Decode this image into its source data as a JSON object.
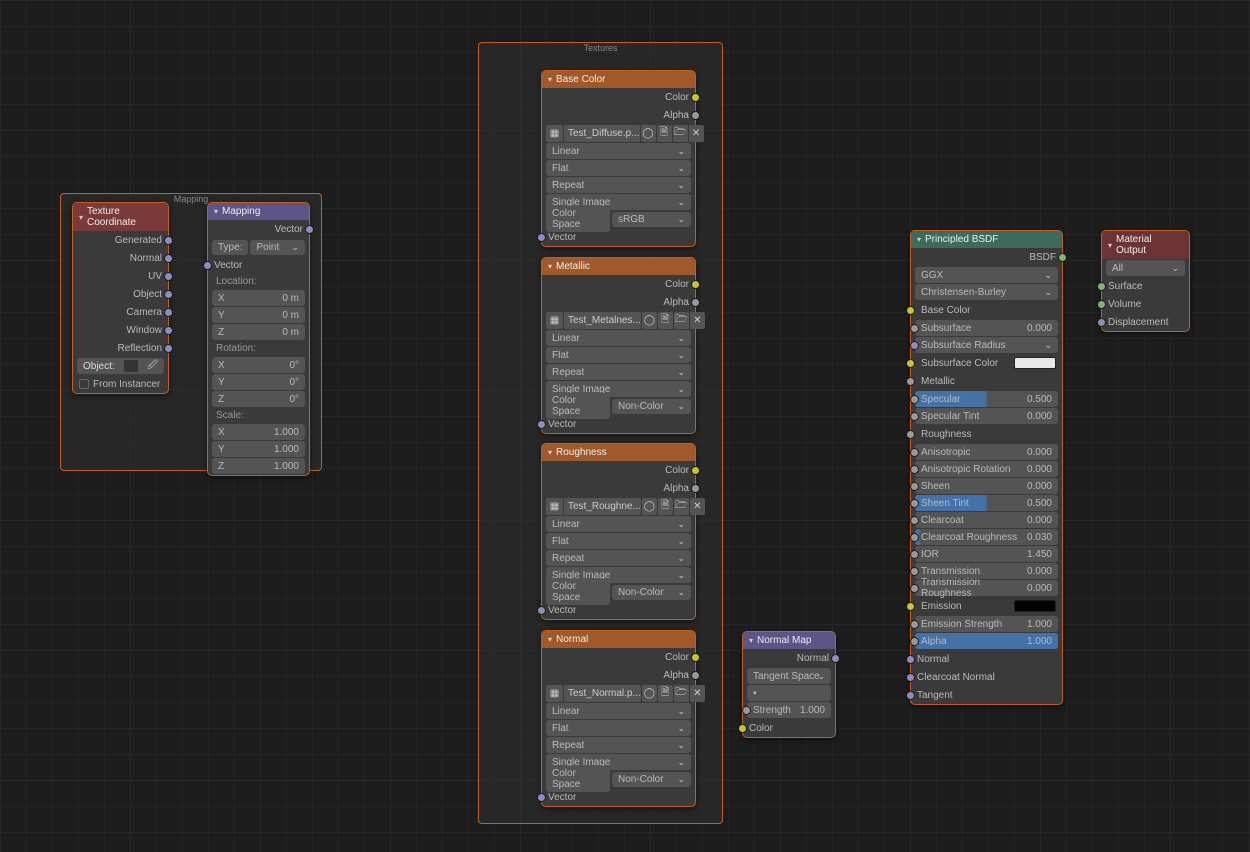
{
  "frames": {
    "mapping": "Mapping",
    "textures": "Textures"
  },
  "texCoord": {
    "title": "Texture Coordinate",
    "outs": [
      "Generated",
      "Normal",
      "UV",
      "Object",
      "Camera",
      "Window",
      "Reflection"
    ],
    "objLabel": "Object:",
    "from": "From Instancer"
  },
  "mapping": {
    "title": "Mapping",
    "out": "Vector",
    "typeLabel": "Type:",
    "type": "Point",
    "vecIn": "Vector",
    "loc": "Location:",
    "rot": "Rotation:",
    "scale": "Scale:",
    "loc_vals": [
      "0 m",
      "0 m",
      "0 m"
    ],
    "rot_vals": [
      "0°",
      "0°",
      "0°"
    ],
    "scale_vals": [
      "1.000",
      "1.000",
      "1.000"
    ],
    "axes": [
      "X",
      "Y",
      "Z"
    ]
  },
  "tex": {
    "titles": [
      "Base Color",
      "Metallic",
      "Roughness",
      "Normal"
    ],
    "files": [
      "Test_Diffuse.p...",
      "Test_Metalnes...",
      "Test_Roughne...",
      "Test_Normal.p..."
    ],
    "interp": "Linear",
    "proj": "Flat",
    "ext": "Repeat",
    "user": "Single Image",
    "csLabel": "Color Space",
    "cs": [
      "sRGB",
      "Non-Color",
      "Non-Color",
      "Non-Color"
    ],
    "outs": [
      "Color",
      "Alpha"
    ],
    "in": "Vector"
  },
  "nmap": {
    "title": "Normal Map",
    "out": "Normal",
    "space": "Tangent Space",
    "strengthL": "Strength",
    "strength": "1.000",
    "colorIn": "Color"
  },
  "bsdf": {
    "title": "Principled BSDF",
    "out": "BSDF",
    "dist": "GGX",
    "sss": "Christensen-Burley",
    "rows": [
      {
        "l": "Base Color",
        "sock": "yellow"
      },
      {
        "l": "Subsurface",
        "v": "0.000",
        "sock": "grey",
        "p": 0
      },
      {
        "l": "Subsurface Radius",
        "sock": "lilac",
        "chev": true
      },
      {
        "l": "Subsurface Color",
        "sock": "yellow",
        "swatch": "#e8e8e8"
      },
      {
        "l": "Metallic",
        "sock": "grey"
      },
      {
        "l": "Specular",
        "v": "0.500",
        "sock": "grey",
        "p": 50
      },
      {
        "l": "Specular Tint",
        "v": "0.000",
        "sock": "grey",
        "p": 0
      },
      {
        "l": "Roughness",
        "sock": "grey"
      },
      {
        "l": "Anisotropic",
        "v": "0.000",
        "sock": "grey",
        "p": 0
      },
      {
        "l": "Anisotropic Rotation",
        "v": "0.000",
        "sock": "grey",
        "p": 0
      },
      {
        "l": "Sheen",
        "v": "0.000",
        "sock": "grey",
        "p": 0
      },
      {
        "l": "Sheen Tint",
        "v": "0.500",
        "sock": "grey",
        "p": 50
      },
      {
        "l": "Clearcoat",
        "v": "0.000",
        "sock": "grey",
        "p": 0
      },
      {
        "l": "Clearcoat Roughness",
        "v": "0.030",
        "sock": "grey",
        "p": 3
      },
      {
        "l": "IOR",
        "v": "1.450",
        "sock": "grey"
      },
      {
        "l": "Transmission",
        "v": "0.000",
        "sock": "grey",
        "p": 0
      },
      {
        "l": "Transmission Roughness",
        "v": "0.000",
        "sock": "grey",
        "p": 0
      },
      {
        "l": "Emission",
        "sock": "yellow",
        "swatch": "#000"
      },
      {
        "l": "Emission Strength",
        "v": "1.000",
        "sock": "grey"
      },
      {
        "l": "Alpha",
        "v": "1.000",
        "sock": "grey",
        "p": 100
      },
      {
        "l": "Normal",
        "sock": "lilac",
        "plain": true
      },
      {
        "l": "Clearcoat Normal",
        "sock": "lilac",
        "plain": true
      },
      {
        "l": "Tangent",
        "sock": "lilac",
        "plain": true
      }
    ]
  },
  "output": {
    "title": "Material Output",
    "target": "All",
    "ins": [
      "Surface",
      "Volume",
      "Displacement"
    ]
  }
}
